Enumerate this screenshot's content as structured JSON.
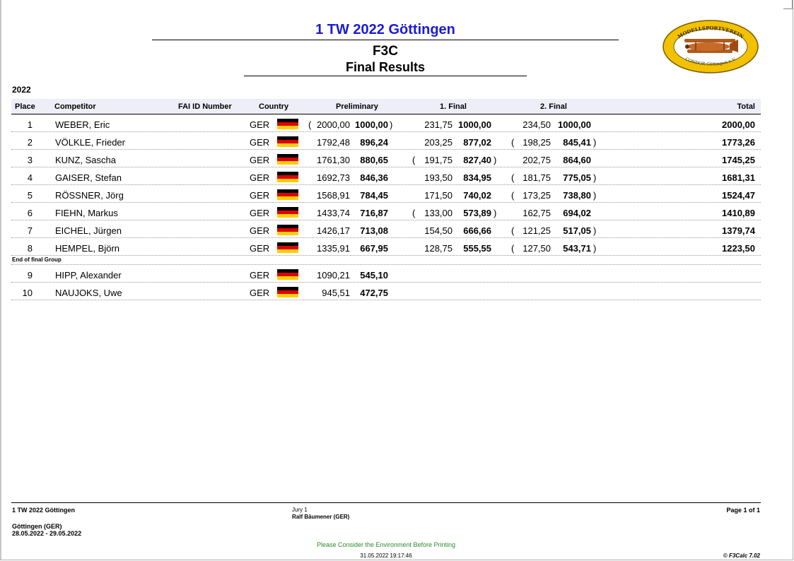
{
  "header": {
    "event_title": "1 TW 2022 Göttingen",
    "class": "F3C",
    "results_title": "Final Results",
    "year": "2022"
  },
  "logo": {
    "top_text": "MODELLSPORTVEREIN",
    "bottom_text": "CONDOR Göttingen e.V."
  },
  "columns": {
    "place": "Place",
    "competitor": "Competitor",
    "fai_id": "FAI ID Number",
    "country": "Country",
    "preliminary": "Preliminary",
    "final1": "1. Final",
    "final2": "2. Final",
    "total": "Total"
  },
  "final_group": [
    {
      "place": "1",
      "name": "WEBER, Eric",
      "country": "GER",
      "pre_raw": "2000,00",
      "pre_norm": "1000,00",
      "pre_drop": true,
      "f1_raw": "231,75",
      "f1_norm": "1000,00",
      "f1_drop": false,
      "f2_raw": "234,50",
      "f2_norm": "1000,00",
      "f2_drop": false,
      "total": "2000,00"
    },
    {
      "place": "2",
      "name": "VÖLKLE, Frieder",
      "country": "GER",
      "pre_raw": "1792,48",
      "pre_norm": "896,24",
      "pre_drop": false,
      "f1_raw": "203,25",
      "f1_norm": "877,02",
      "f1_drop": false,
      "f2_raw": "198,25",
      "f2_norm": "845,41",
      "f2_drop": true,
      "total": "1773,26"
    },
    {
      "place": "3",
      "name": "KUNZ, Sascha",
      "country": "GER",
      "pre_raw": "1761,30",
      "pre_norm": "880,65",
      "pre_drop": false,
      "f1_raw": "191,75",
      "f1_norm": "827,40",
      "f1_drop": true,
      "f2_raw": "202,75",
      "f2_norm": "864,60",
      "f2_drop": false,
      "total": "1745,25"
    },
    {
      "place": "4",
      "name": "GAISER, Stefan",
      "country": "GER",
      "pre_raw": "1692,73",
      "pre_norm": "846,36",
      "pre_drop": false,
      "f1_raw": "193,50",
      "f1_norm": "834,95",
      "f1_drop": false,
      "f2_raw": "181,75",
      "f2_norm": "775,05",
      "f2_drop": true,
      "total": "1681,31"
    },
    {
      "place": "5",
      "name": "RÖSSNER, Jörg",
      "country": "GER",
      "pre_raw": "1568,91",
      "pre_norm": "784,45",
      "pre_drop": false,
      "f1_raw": "171,50",
      "f1_norm": "740,02",
      "f1_drop": false,
      "f2_raw": "173,25",
      "f2_norm": "738,80",
      "f2_drop": true,
      "total": "1524,47"
    },
    {
      "place": "6",
      "name": "FIEHN, Markus",
      "country": "GER",
      "pre_raw": "1433,74",
      "pre_norm": "716,87",
      "pre_drop": false,
      "f1_raw": "133,00",
      "f1_norm": "573,89",
      "f1_drop": true,
      "f2_raw": "162,75",
      "f2_norm": "694,02",
      "f2_drop": false,
      "total": "1410,89"
    },
    {
      "place": "7",
      "name": "EICHEL, Jürgen",
      "country": "GER",
      "pre_raw": "1426,17",
      "pre_norm": "713,08",
      "pre_drop": false,
      "f1_raw": "154,50",
      "f1_norm": "666,66",
      "f1_drop": false,
      "f2_raw": "121,25",
      "f2_norm": "517,05",
      "f2_drop": true,
      "total": "1379,74"
    },
    {
      "place": "8",
      "name": "HEMPEL, Björn",
      "country": "GER",
      "pre_raw": "1335,91",
      "pre_norm": "667,95",
      "pre_drop": false,
      "f1_raw": "128,75",
      "f1_norm": "555,55",
      "f1_drop": false,
      "f2_raw": "127,50",
      "f2_norm": "543,71",
      "f2_drop": true,
      "total": "1223,50"
    }
  ],
  "group_separator": "End of final Group",
  "others": [
    {
      "place": "9",
      "name": "HIPP, Alexander",
      "country": "GER",
      "pre_raw": "1090,21",
      "pre_norm": "545,10"
    },
    {
      "place": "10",
      "name": "NAUJOKS, Uwe",
      "country": "GER",
      "pre_raw": "945,51",
      "pre_norm": "472,75"
    }
  ],
  "footer": {
    "event": "1 TW 2022 Göttingen",
    "location": "Göttingen (GER)",
    "dates": "28.05.2022 - 29.05.2022",
    "jury_label": "Jury 1",
    "jury_name": "Ralf Bäumener (GER)",
    "page": "Page 1 of 1",
    "environment_note": "Please Consider the Environment Before Printing",
    "timestamp": "31.05.2022 19:17:46",
    "copyright": "© F3Calc 7.02"
  },
  "colors": {
    "title": "#1a1ad6",
    "environment_note": "#2e8b2e",
    "header_bg": "#eeeef8"
  }
}
